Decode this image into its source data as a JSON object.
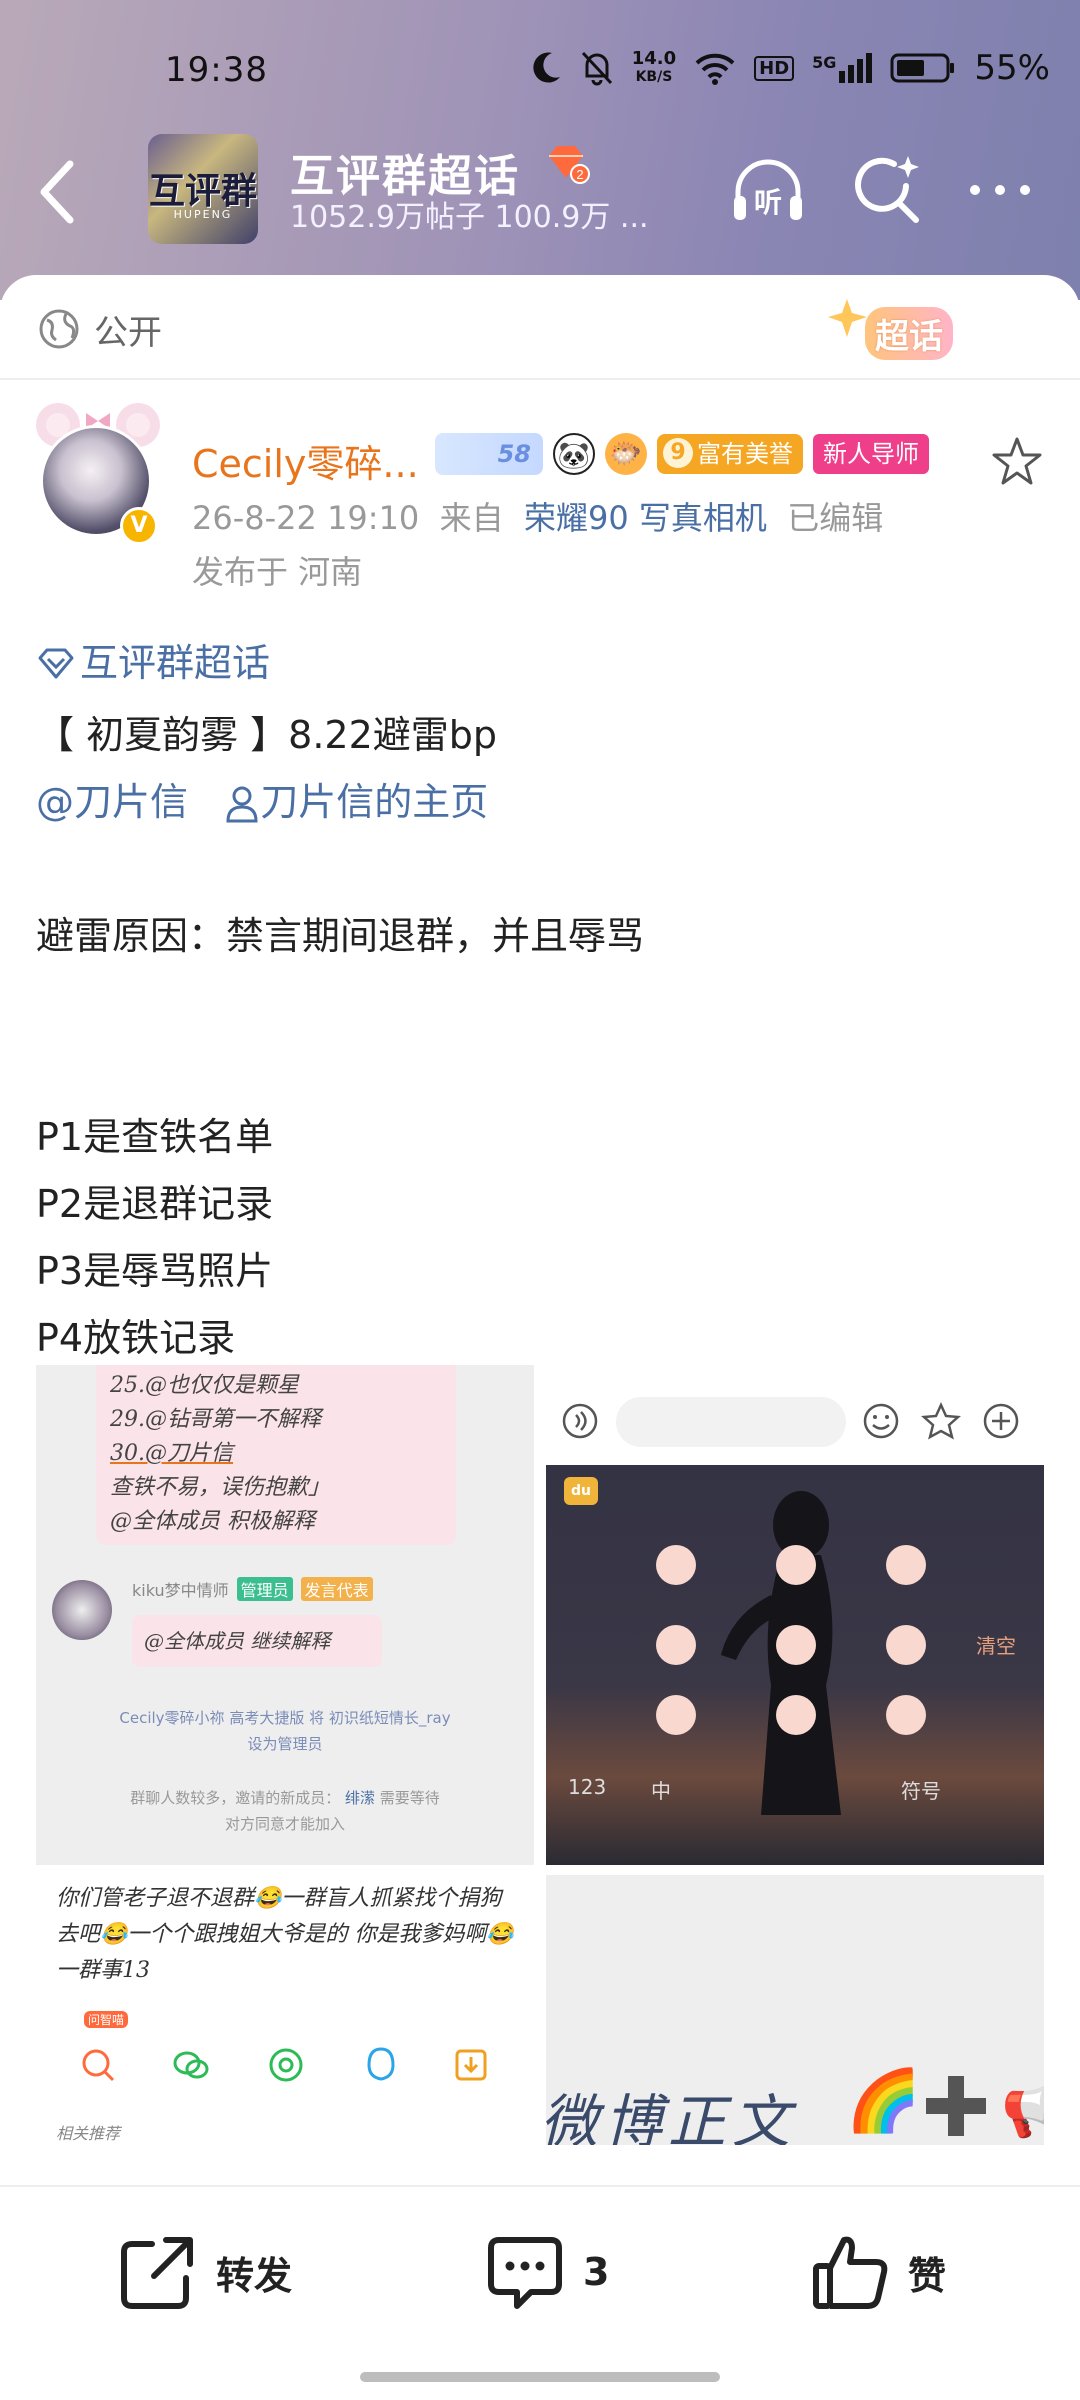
{
  "status_bar": {
    "time": "19:38",
    "net_speed_value": "14.0",
    "net_speed_unit": "KB/S",
    "hd": "HD",
    "signal": "5G",
    "battery": "55%"
  },
  "header": {
    "topic_title": "互评群超话",
    "topic_stats": "1052.9万帖子 100.9万 ...",
    "avatar_text": "互评群",
    "avatar_sub": "HUPENG",
    "level": "2",
    "listen_label": "听"
  },
  "visibility": {
    "label": "公开",
    "chaohua_tag": "超话"
  },
  "author": {
    "name": "Cecily零碎...",
    "badges": {
      "sb": "58",
      "rich": "富有美誉",
      "mentor": "新人导师"
    },
    "meta_time": "26-8-22 19:10",
    "meta_from": "来自",
    "meta_source": "荣耀90 写真相机",
    "meta_edited": "已编辑",
    "location": "发布于 河南"
  },
  "post": {
    "topic_link": "互评群超话",
    "title_line": "【 初夏韵雾 】8.22避雷bp",
    "mention": "@刀片信",
    "homepage_link": "刀片信的主页",
    "reason": "避雷原因：禁言期间退群，并且辱骂",
    "p1": "P1是查铁名单",
    "p2": "P2是退群记录",
    "p3": "P3是辱骂照片",
    "p4": "P4放铁记录"
  },
  "images": {
    "img1": {
      "line1": "25.@也仅仅是颗星",
      "line2": "29.@钻哥第一不解释",
      "line3": "30.@刀片信",
      "line4": "查铁不易，误伤抱歉」",
      "line5": "@全体成员 积极解释",
      "admin_name": "kiku梦中情师",
      "admin_tag": "管理员",
      "speaker_tag": "发言代表",
      "bubble": "@全体成员 继续解释",
      "sys1": "Cecily零碎小祢 高考大捷版 将 初识纸短情长_ray",
      "sys2": "设为管理员",
      "sys3": "群聊人数较多，邀请的新成员：",
      "sys3_name": "绯潆",
      "sys3_tail": "需要等待",
      "sys4": "对方同意才能加入"
    },
    "img2": {
      "key_123": "123",
      "key_cn": "中",
      "key_symbol": "符号",
      "key_clear": "清空",
      "key_du": "du"
    },
    "img3": {
      "text": "你们管老子退不退群😂一群盲人抓紧找个捐狗去吧😂一个个跟拽姐大爷是的 你是我爹妈啊😂一群事13",
      "related": "相关推荐",
      "ai_tag": "问智喵"
    },
    "img4": {
      "text": "微博正文"
    }
  },
  "actions": {
    "share": "转发",
    "comment_count": "3",
    "like": "赞"
  }
}
